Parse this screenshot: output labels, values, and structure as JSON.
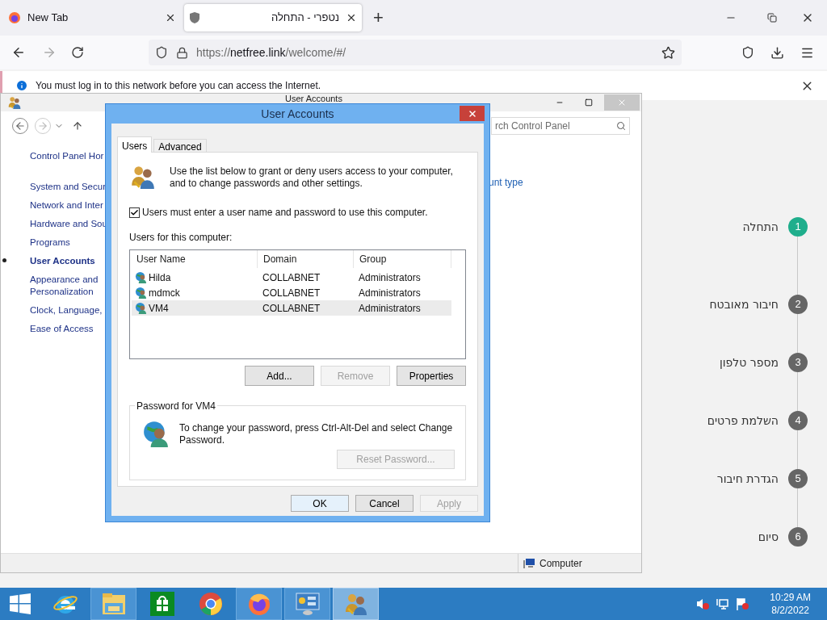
{
  "browser": {
    "tabs": [
      {
        "title": "New Tab",
        "selected": false
      },
      {
        "title": "נטפרי - התחלה",
        "selected": true
      }
    ],
    "new_tab": "+",
    "url": {
      "scheme": "https://",
      "host": "netfree.link",
      "path": "/welcome/#/"
    },
    "notification": "You must log in to this network before you can access the Internet."
  },
  "control_panel": {
    "title": "User Accounts",
    "search": "rch Control Panel",
    "nav": [
      {
        "label": "Control Panel Hor",
        "selected": false
      },
      {
        "label": "System and Secur",
        "selected": false
      },
      {
        "label": "Network and Inter",
        "selected": false
      },
      {
        "label": "Hardware and Sou",
        "selected": false
      },
      {
        "label": "Programs",
        "selected": false
      },
      {
        "label": "User Accounts",
        "selected": true
      },
      {
        "label": "Appearance and Personalization",
        "selected": false
      },
      {
        "label": "Clock, Language,",
        "selected": false
      },
      {
        "label": "Ease of Access",
        "selected": false
      }
    ],
    "link": "unt type",
    "status": "Computer"
  },
  "dialog": {
    "title": "User Accounts",
    "tabs": [
      {
        "label": "Users",
        "selected": true
      },
      {
        "label": "Advanced",
        "selected": false
      }
    ],
    "intro": "Use the list below to grant or deny users access to your computer, and to change passwords and other settings.",
    "require_login": {
      "label": "Users must enter a user name and password to use this computer.",
      "checked": true
    },
    "list_label": "Users for this computer:",
    "columns": [
      "User Name",
      "Domain",
      "Group"
    ],
    "rows": [
      {
        "cells": [
          "Hilda",
          "COLLABNET",
          "Administrators"
        ],
        "selected": false
      },
      {
        "cells": [
          "mdmck",
          "COLLABNET",
          "Administrators"
        ],
        "selected": false
      },
      {
        "cells": [
          "VM4",
          "COLLABNET",
          "Administrators"
        ],
        "selected": true
      }
    ],
    "list_buttons": [
      {
        "label": "Add...",
        "disabled": false
      },
      {
        "label": "Remove",
        "disabled": true
      },
      {
        "label": "Properties",
        "disabled": false
      }
    ],
    "password": {
      "title": "Password for VM4",
      "text": "To change your password, press Ctrl-Alt-Del and select Change Password.",
      "button": {
        "label": "Reset Password...",
        "disabled": true
      }
    },
    "footer_buttons": [
      {
        "label": "OK",
        "disabled": false,
        "default": true
      },
      {
        "label": "Cancel",
        "disabled": false,
        "default": false
      },
      {
        "label": "Apply",
        "disabled": true,
        "default": false
      }
    ]
  },
  "stepper": [
    {
      "number": "1",
      "label": "התחלה",
      "selected": true
    },
    {
      "number": "2",
      "label": "חיבור מאובטח",
      "selected": false
    },
    {
      "number": "3",
      "label": "מספר טלפון",
      "selected": false
    },
    {
      "number": "4",
      "label": "השלמת פרטים",
      "selected": false
    },
    {
      "number": "5",
      "label": "הגדרת חיבור",
      "selected": false
    },
    {
      "number": "6",
      "label": "סיום",
      "selected": false
    }
  ],
  "taskbar": {
    "apps": [
      {
        "kind": "ie",
        "open": false,
        "selected": false
      },
      {
        "kind": "explorer",
        "open": true,
        "selected": false
      },
      {
        "kind": "store",
        "open": false,
        "selected": false
      },
      {
        "kind": "chrome",
        "open": false,
        "selected": false
      },
      {
        "kind": "firefox",
        "open": true,
        "selected": false
      },
      {
        "kind": "control",
        "open": true,
        "selected": false
      },
      {
        "kind": "users",
        "open": true,
        "selected": true
      }
    ],
    "time": "10:29 AM",
    "date": "8/2/2022"
  }
}
